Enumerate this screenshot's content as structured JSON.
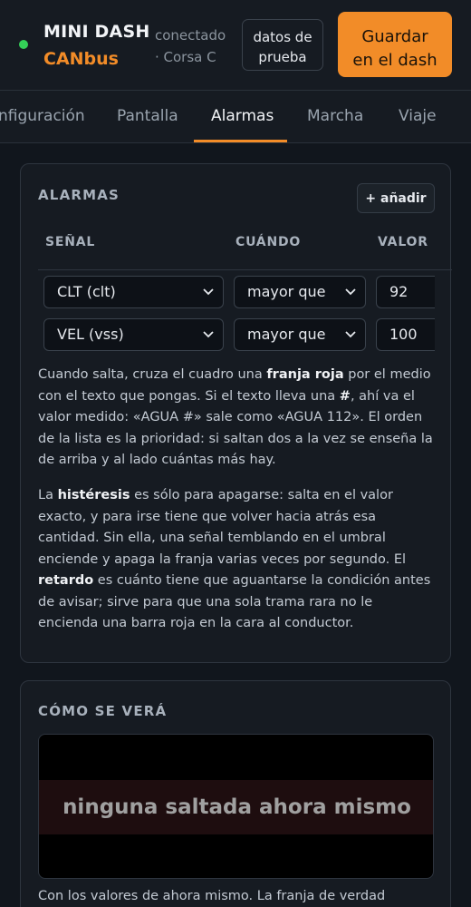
{
  "header": {
    "brand_line1": "MINI DASH",
    "brand_line2": "CANbus",
    "connection_status": "conectado",
    "connection_vehicle": "· Corsa C",
    "test_button_line1": "datos de",
    "test_button_line2": "prueba",
    "save_button_line1": "Guardar",
    "save_button_line2": "en el dash",
    "status_color": "#34d058",
    "accent_color": "#f28c28"
  },
  "tabs": [
    {
      "label": "Configuración",
      "visible_label": "nfiguración",
      "active": false
    },
    {
      "label": "Pantalla",
      "active": false
    },
    {
      "label": "Alarmas",
      "active": true
    },
    {
      "label": "Marcha",
      "active": false
    },
    {
      "label": "Viaje",
      "active": false
    }
  ],
  "alarms": {
    "title": "ALARMAS",
    "add_button": "+ añadir",
    "columns": [
      "SEÑAL",
      "CUÁNDO",
      "VALOR"
    ],
    "rows": [
      {
        "signal": "CLT (clt)",
        "condition": "mayor que",
        "value": "92"
      },
      {
        "signal": "VEL (vss)",
        "condition": "mayor que",
        "value": "100"
      }
    ],
    "help1": {
      "t1": "Cuando salta, cruza el cuadro una ",
      "b1": "franja roja",
      "t2": " por el medio con el texto que pongas. Si el texto lleva una ",
      "b2": "#",
      "t3": ", ahí va el valor medido: «AGUA #» sale como «AGUA 112». El orden de la lista es la prioridad: si saltan dos a la vez se enseña la de arriba y al lado cuántas más hay."
    },
    "help2": {
      "t1": "La ",
      "b1": "histéresis",
      "t2": " es sólo para apagarse: salta en el valor exacto, y para irse tiene que volver hacia atrás esa cantidad. Sin ella, una señal temblando en el umbral enciende y apaga la franja varias veces por segundo. El ",
      "b2": "retardo",
      "t3": " es cuánto tiene que aguantarse la condición antes de avisar; sirve para que una sola trama rara no le encienda una barra roja en la cara al conductor."
    }
  },
  "preview": {
    "title": "CÓMO SE VERÁ",
    "message": "ninguna saltada ahora mismo",
    "footer": "Con los valores de ahora mismo. La franja de verdad"
  }
}
